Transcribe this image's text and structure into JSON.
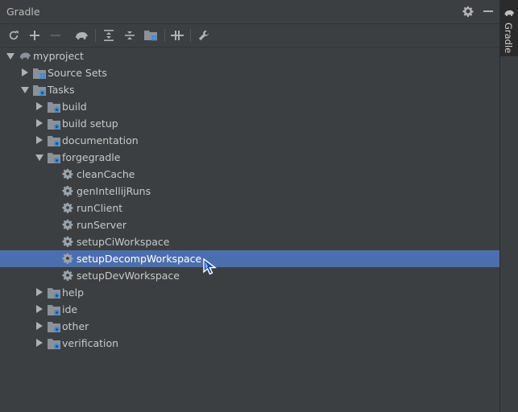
{
  "panel": {
    "title": "Gradle",
    "side_tab_label": "Gradle"
  },
  "toolbar": {
    "buttons": [
      {
        "name": "refresh-icon"
      },
      {
        "name": "plus-icon"
      },
      {
        "name": "minus-icon"
      },
      {
        "name": "elephant-icon"
      },
      {
        "name": "expand-all-icon"
      },
      {
        "name": "collapse-all-icon"
      },
      {
        "name": "folder-grid-icon"
      },
      {
        "name": "toggle-offline-icon"
      },
      {
        "name": "wrench-icon"
      }
    ]
  },
  "tree": {
    "root": "myproject",
    "source_sets": "Source Sets",
    "tasks": "Tasks",
    "groups": {
      "build": "build",
      "build_setup": "build setup",
      "documentation": "documentation",
      "forgegradle": "forgegradle",
      "help": "help",
      "ide": "ide",
      "other": "other",
      "verification": "verification"
    },
    "forgegradle_tasks": [
      "cleanCache",
      "genIntellijRuns",
      "runClient",
      "runServer",
      "setupCiWorkspace",
      "setupDecompWorkspace",
      "setupDevWorkspace"
    ]
  },
  "colors": {
    "panel_bg": "#3c3f41",
    "selection": "#4b6eaf",
    "folder_icon": "#8a9198",
    "gear_icon": "#9aa2aa",
    "badge_blue": "#3d8bd9"
  }
}
